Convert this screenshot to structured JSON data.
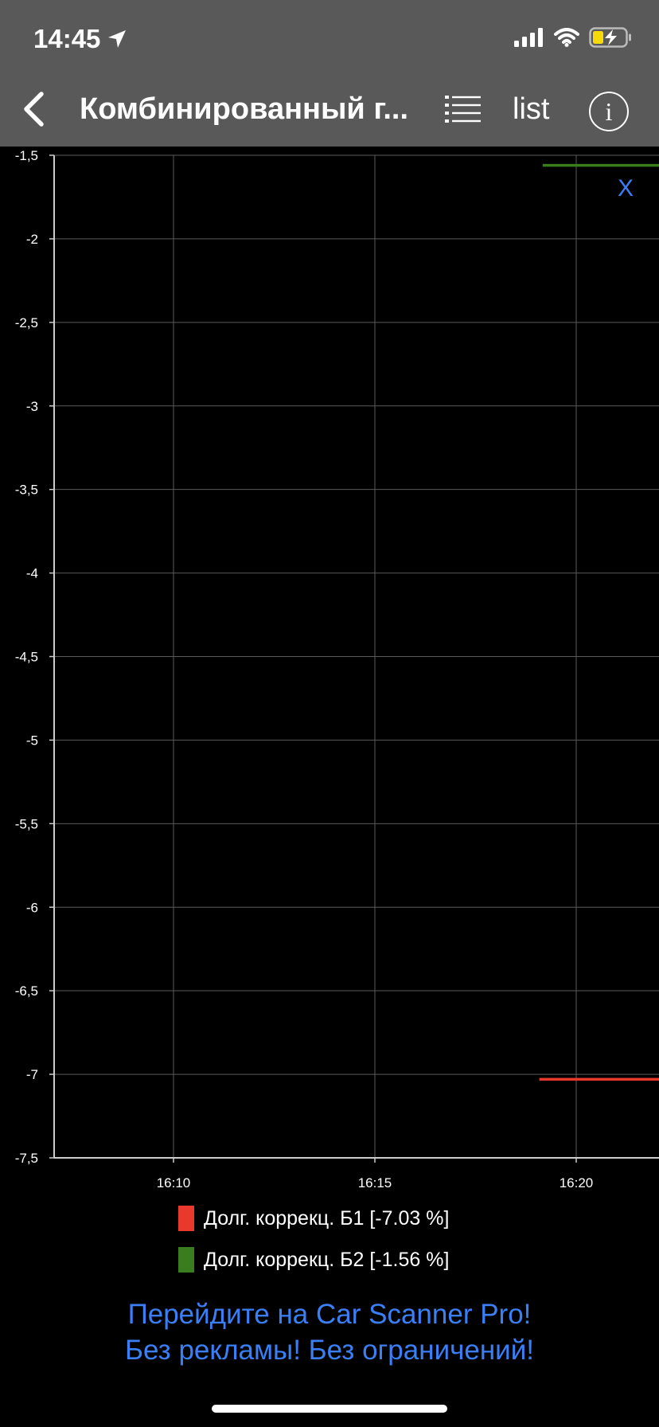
{
  "status_bar": {
    "time": "14:45",
    "icons": [
      "location-arrow-icon",
      "signal-icon",
      "wifi-icon",
      "battery-charging-icon"
    ]
  },
  "nav": {
    "back_icon": "chevron-left-icon",
    "title": "Комбинированный г...",
    "list_icon": "list-icon",
    "list_label": "list",
    "info_label": "i"
  },
  "chart_close_label": "X",
  "chart_data": {
    "type": "line",
    "y_ticks": [
      "-1,5",
      "-2",
      "-2,5",
      "-3",
      "-3,5",
      "-4",
      "-4,5",
      "-5",
      "-5,5",
      "-6",
      "-6,5",
      "-7",
      "-7,5"
    ],
    "x_ticks": [
      "16:10",
      "16:15",
      "16:20"
    ],
    "ylim": [
      -7.5,
      -1.5
    ],
    "grid": true,
    "series": [
      {
        "name": "Долг. коррекц. Б1 [-7.03 %]",
        "color": "#e8392c",
        "points": [
          [
            "16:19:05",
            -7.03
          ],
          [
            "16:22:10",
            -7.03
          ]
        ]
      },
      {
        "name": "Долг. коррекц. Б2 [-1.56 %]",
        "color": "#3a7d1f",
        "points": [
          [
            "16:19:10",
            -1.56
          ],
          [
            "16:22:10",
            -1.56
          ]
        ]
      }
    ]
  },
  "legend": {
    "items": [
      {
        "label": "Долг. коррекц. Б1 [-7.03 %]",
        "color": "#e8392c"
      },
      {
        "label": "Долг. коррекц. Б2 [-1.56 %]",
        "color": "#3a7d1f"
      }
    ]
  },
  "promo": {
    "line1": "Перейдите на Car Scanner Pro!",
    "line2": "Без рекламы! Без ограничений!"
  }
}
